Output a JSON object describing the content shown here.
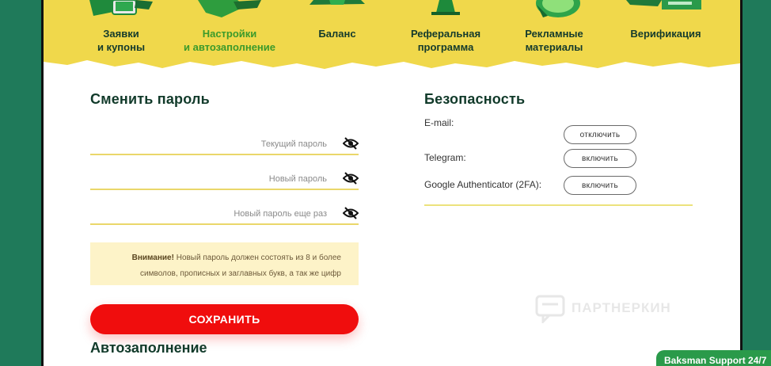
{
  "nav": {
    "items": [
      {
        "label": "Заявки\nи купоны",
        "icon": "phone-coupon-icon",
        "active": false
      },
      {
        "label": "Настройки\nи автозаполнение",
        "icon": "settings-icon",
        "active": true
      },
      {
        "label": "Баланс",
        "icon": "balance-icon",
        "active": false
      },
      {
        "label": "Реферальная\nпрограмма",
        "icon": "referral-icon",
        "active": false
      },
      {
        "label": "Рекламные\nматериалы",
        "icon": "ad-materials-icon",
        "active": false
      },
      {
        "label": "Верификация",
        "icon": "verification-icon",
        "active": false
      }
    ]
  },
  "password": {
    "title": "Сменить пароль",
    "current_placeholder": "Текущий пароль",
    "new_placeholder": "Новый пароль",
    "repeat_placeholder": "Новый пароль еще раз",
    "notice_bold": "Внимание!",
    "notice_text": " Новый пароль должен состоять из 8 и более символов, прописных и заглавных букв, а так же цифр",
    "save_label": "СОХРАНИТЬ"
  },
  "security": {
    "title": "Безопасность",
    "rows": [
      {
        "label": "E-mail:",
        "button": "отключить"
      },
      {
        "label": "Telegram:",
        "button": "включить"
      },
      {
        "label": "Google Authenticator (2FA):",
        "button": "включить"
      }
    ]
  },
  "autofill": {
    "title": "Автозаполнение"
  },
  "watermark": {
    "text": "ПАРТНЕРКИН"
  },
  "support": {
    "label": "Baksman Support 24/7"
  },
  "colors": {
    "header_yellow": "#f0d84b",
    "accent_green": "#3b9a2b",
    "save_red": "#f00d0d",
    "notice_bg": "#fdf3c8",
    "outer_green": "#1f7a5a"
  }
}
